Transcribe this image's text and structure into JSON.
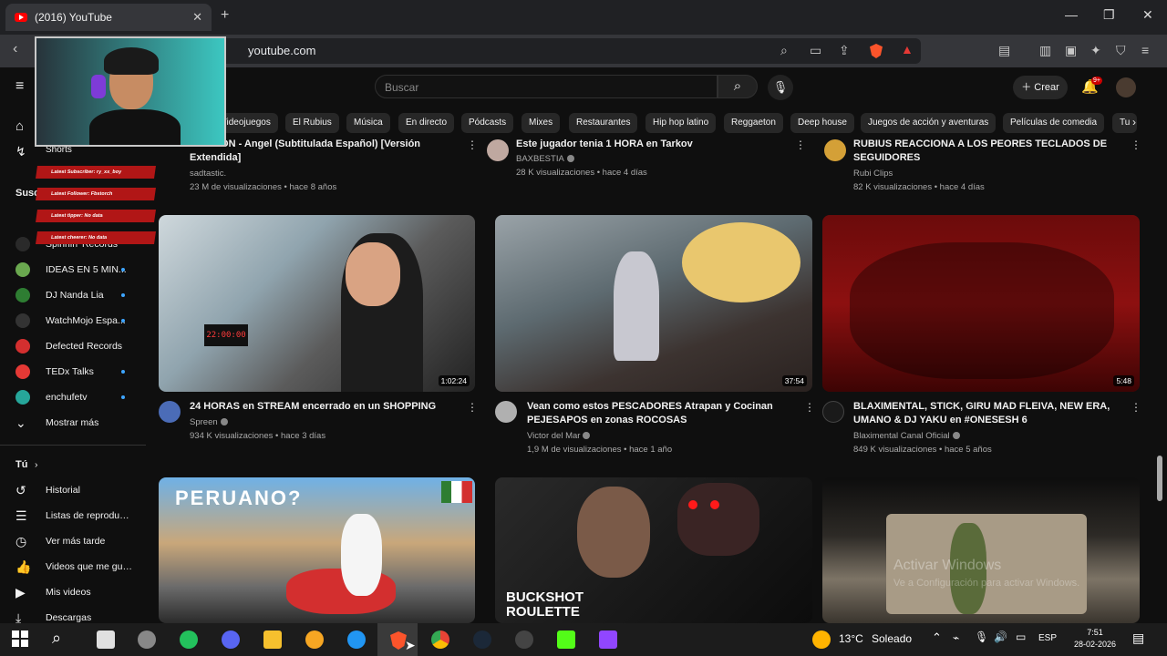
{
  "browser": {
    "tab_title": "(2016) YouTube",
    "url": "youtube.com",
    "brave_badge": "96+"
  },
  "youtube": {
    "search_placeholder": "Buscar",
    "create_label": "Crear",
    "notifications_badge": "9+"
  },
  "chips": [
    "Videojuegos",
    "El Rubius",
    "Música",
    "En directo",
    "Pódcasts",
    "Mixes",
    "Restaurantes",
    "Hip hop latino",
    "Reggaeton",
    "Deep house",
    "Juegos de acción y aventuras",
    "Películas de comedia",
    "Tu"
  ],
  "sidebar": {
    "shorts": "Shorts",
    "subscriptions_heading": "Susc",
    "channels": [
      {
        "label": "Spinnin' Records"
      },
      {
        "label": "IDEAS EN 5 MIN..."
      },
      {
        "label": "DJ Nanda Lia"
      },
      {
        "label": "WatchMojo Espa..."
      },
      {
        "label": "Defected Records"
      },
      {
        "label": "TEDx Talks"
      },
      {
        "label": "enchufetv"
      }
    ],
    "show_more": "Mostrar más",
    "you_heading": "Tú",
    "you_items": [
      {
        "label": "Historial"
      },
      {
        "label": "Listas de reproducc..."
      },
      {
        "label": "Ver más tarde"
      },
      {
        "label": "Videos que me gus..."
      },
      {
        "label": "Mis videos"
      },
      {
        "label": "Descargas"
      }
    ]
  },
  "stream_overlay": [
    "Latest Subscriber: ry_xx_boy",
    "Latest Follower: Fbstorch",
    "Latest tipper: No data",
    "Latest cheerer: No data"
  ],
  "videos_top": [
    {
      "title": "...TACION - Angel (Subtitulada Español) [Versión Extendida]",
      "channel": "sadtastic.",
      "meta": "23 M de visualizaciones • hace 8 años"
    },
    {
      "title": "Este jugador tenia 1 HORA en Tarkov",
      "channel": "BAXBESTIA",
      "meta": "28 K visualizaciones • hace 4 días"
    },
    {
      "title": "RUBIUS REACCIONA A LOS PEORES TECLADOS DE SEGUIDORES",
      "channel": "Rubi Clips",
      "meta": "82 K visualizaciones • hace 4 días"
    }
  ],
  "videos_mid": [
    {
      "title": "24 HORAS en STREAM encerrado en un SHOPPING",
      "channel": "Spreen",
      "meta": "934 K visualizaciones • hace 3 días",
      "duration": "1:02:24",
      "thumb_clock": "22:00:00"
    },
    {
      "title": "Vean como estos PESCADORES Atrapan y Cocinan PEJESAPOS en zonas ROCOSAS",
      "channel": "Victor del Mar",
      "meta": "1,9 M de visualizaciones • hace 1 año",
      "duration": "37:54"
    },
    {
      "title": "BLAXIMENTAL, STICK, GIRU MAD FLEIVA, NEW ERA, UMANO & DJ YAKU en #ONESESH 6",
      "channel": "Blaximental Canal Oficial",
      "meta": "849 K visualizaciones • hace 5 años",
      "duration": "5:48"
    }
  ],
  "videos_bottom": [
    {
      "thumb_text": "PERUANO?"
    },
    {
      "thumb_text": "BUCKSHOT ROULETTE"
    },
    {
      "thumb_text": ""
    }
  ],
  "watermark": {
    "line1": "Activar Windows",
    "line2": "Ve a Configuración para activar Windows."
  },
  "taskbar": {
    "temperature": "13°C",
    "weather": "Soleado",
    "language": "ESP",
    "time": "7:51",
    "date": "28-02-2026"
  }
}
